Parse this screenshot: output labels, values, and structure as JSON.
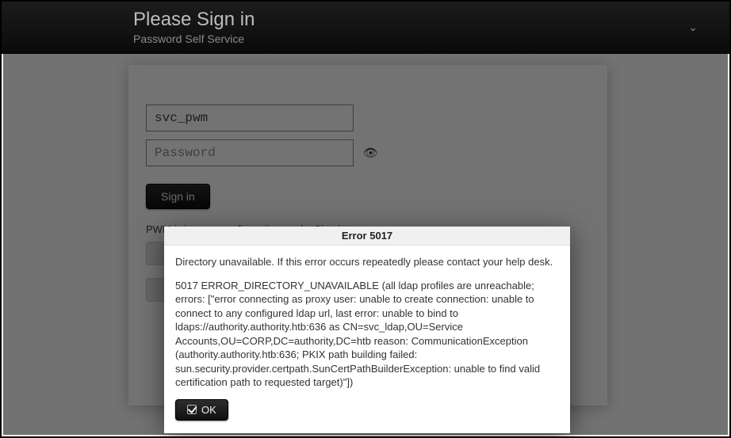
{
  "header": {
    "title": "Please Sign in",
    "subtitle": "Password Self Service"
  },
  "form": {
    "username_value": "svc_pwm",
    "password_placeholder": "Password",
    "signin_label": "Sign in"
  },
  "config_note": "PWM is in open configuration mode. Sign in to …",
  "modal": {
    "title": "Error 5017",
    "summary": "Directory unavailable. If this error occurs repeatedly please contact your help desk.",
    "detail": "5017 ERROR_DIRECTORY_UNAVAILABLE (all ldap profiles are unreachable; errors: [\"error connecting as proxy user: unable to create connection: unable to connect to any configured ldap url, last error: unable to bind to ldaps://authority.authority.htb:636 as CN=svc_ldap,OU=Service Accounts,OU=CORP,DC=authority,DC=htb reason: CommunicationException (authority.authority.htb:636; PKIX path building failed: sun.security.provider.certpath.SunCertPathBuilderException: unable to find valid certification path to requested target)\"])",
    "ok_label": "OK"
  }
}
